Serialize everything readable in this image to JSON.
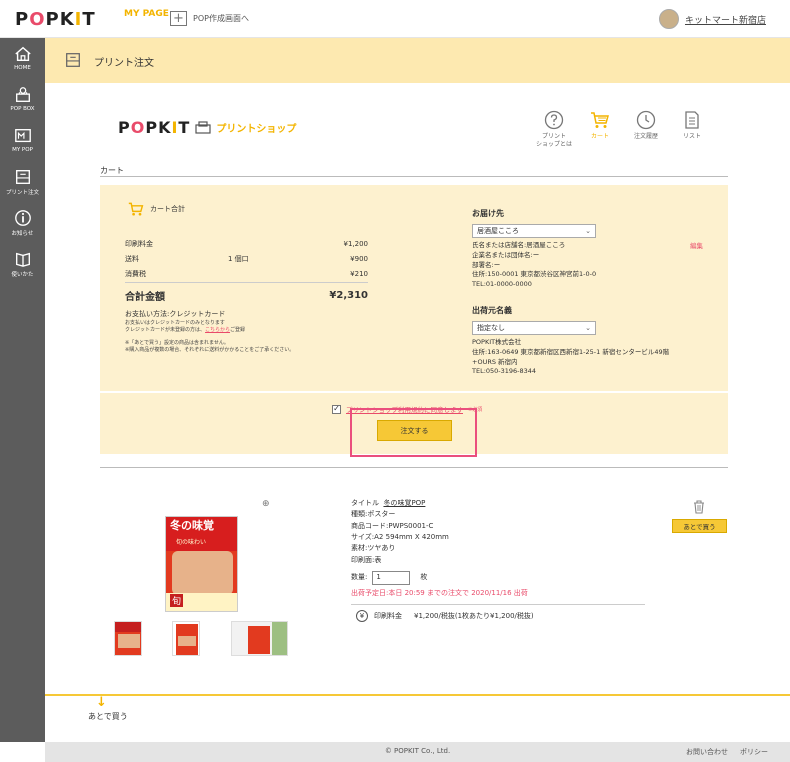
{
  "header": {
    "logo_text": "POPKIT",
    "mypage_label": "MY PAGE",
    "pop_create_label": "POP作成画面へ",
    "user_name": "キットマート新宿店"
  },
  "sidebar": {
    "items": [
      {
        "label": "HOME",
        "icon": "home-icon"
      },
      {
        "label": "POP BOX",
        "icon": "pop-box-icon"
      },
      {
        "label": "MY POP",
        "icon": "my-pop-icon"
      },
      {
        "label": "プリント注文",
        "icon": "print-order-icon"
      },
      {
        "label": "お知らせ",
        "icon": "info-icon"
      },
      {
        "label": "使いかた",
        "icon": "book-icon"
      }
    ]
  },
  "page_title": "プリント注文",
  "shop": {
    "logo_text": "POPKIT",
    "subtitle": "プリントショップ",
    "nav": [
      {
        "label": "プリント\nショップとは",
        "icon": "question-icon",
        "active": false
      },
      {
        "label": "カート",
        "icon": "cart-icon",
        "active": true
      },
      {
        "label": "注文履歴",
        "icon": "clock-icon",
        "active": false
      },
      {
        "label": "リスト",
        "icon": "list-icon",
        "active": false
      }
    ]
  },
  "cart": {
    "section_label": "カート",
    "total_header": "カート合計",
    "rows": {
      "print_fee_label": "印刷料金",
      "print_fee": "¥1,200",
      "shipping_label": "送料",
      "shipping_mid": "1 個口",
      "shipping": "¥900",
      "tax_label": "消費税",
      "tax": "¥210",
      "total_label": "合計金額",
      "total": "¥2,310"
    },
    "payment": {
      "method": "お支払い方法:クレジットカード",
      "note1": "お支払いはクレジットカードのみとなります",
      "note2_prefix": "クレジットカードが未登録の方は、",
      "note2_link": "こちらから",
      "note2_suffix": "ご登録",
      "note3": "※「あとで買う」設定の商品は含まれません。",
      "note4": "※購入商品が複数の場合、それぞれに送料がかかることをご了承ください。"
    },
    "shipping_to": {
      "heading": "お届け先",
      "selected": "居酒屋こころ",
      "edit_label": "編集",
      "lines": [
        "氏名または店舗名:居酒屋こころ",
        "企業名または団体名:ー",
        "部署名:ー",
        "住所:150-0001 東京都渋谷区神宮前1-0-0",
        "TEL:01-0000-0000"
      ]
    },
    "sender": {
      "heading": "出荷元名義",
      "selected": "指定なし",
      "lines": [
        "POPKIT株式会社",
        "住所:163-0649 東京都新宿区西新宿1-25-1 新宿センタービル49階",
        "+OURS 新宿内",
        "TEL:050-3196-8344"
      ]
    },
    "agree_text": "プリントショップ利用規約に同意します",
    "required": "※必須",
    "order_button": "注文する"
  },
  "item": {
    "title_prefix": "タイトル",
    "title": "冬の味覚POP",
    "type": "種類:ポスター",
    "code": "商品コード:PWPS0001-C",
    "size": "サイズ:A2 594mm X 420mm",
    "material": "素材:ツヤあり",
    "side": "印刷面:表",
    "qty_label": "数量:",
    "qty_value": "1",
    "qty_unit": "枚",
    "ship_date": "出荷予定日:本日 20:59 までの注文で 2020/11/16 出荷",
    "price_label": "印刷料金",
    "price": "¥1,200/税抜(1枚あたり¥1,200/税抜)",
    "later_button": "あとで買う",
    "poster_title": "冬の味覚",
    "poster_sub": "旬の味わい",
    "poster_mark": "旬"
  },
  "later_section": "あとで買う",
  "footer": {
    "copyright": "© POPKIT Co., Ltd.",
    "contact": "お問い合わせ",
    "policy": "ポリシー"
  }
}
